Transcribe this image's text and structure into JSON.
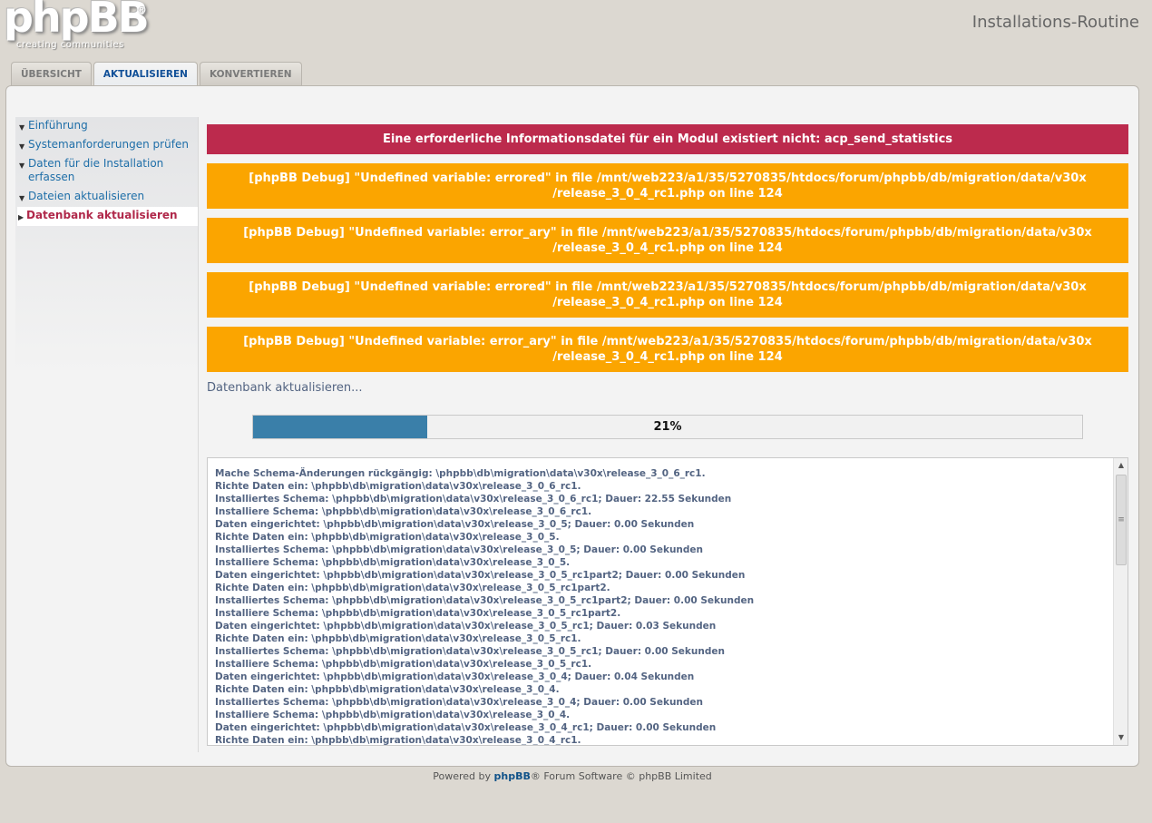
{
  "header": {
    "logo_text": "phpBB",
    "logo_registered": "®",
    "logo_tagline": "creating   communities",
    "page_title": "Installations-Routine"
  },
  "tabs": [
    {
      "label": "ÜBERSICHT",
      "active": false
    },
    {
      "label": "AKTUALISIEREN",
      "active": true
    },
    {
      "label": "KONVERTIEREN",
      "active": false
    }
  ],
  "sidebar": {
    "items": [
      {
        "label": "Einführung"
      },
      {
        "label": "Systemanforderungen prüfen"
      },
      {
        "label": "Daten für die Installation erfassen"
      },
      {
        "label": "Dateien aktualisieren"
      },
      {
        "label": "Datenbank aktualisieren",
        "active": true
      }
    ]
  },
  "messages": {
    "error": "Eine erforderliche Informationsdatei für ein Modul existiert nicht: acp_send_statistics",
    "debug": [
      {
        "line1": "[phpBB Debug] \"Undefined variable: errored\" in file /mnt/web223/a1/35/5270835/htdocs/forum/phpbb/db/migration/data/v30x",
        "line2": "/release_3_0_4_rc1.php on line 124"
      },
      {
        "line1": "[phpBB Debug] \"Undefined variable: error_ary\" in file /mnt/web223/a1/35/5270835/htdocs/forum/phpbb/db/migration/data/v30x",
        "line2": "/release_3_0_4_rc1.php on line 124"
      },
      {
        "line1": "[phpBB Debug] \"Undefined variable: errored\" in file /mnt/web223/a1/35/5270835/htdocs/forum/phpbb/db/migration/data/v30x",
        "line2": "/release_3_0_4_rc1.php on line 124"
      },
      {
        "line1": "[phpBB Debug] \"Undefined variable: error_ary\" in file /mnt/web223/a1/35/5270835/htdocs/forum/phpbb/db/migration/data/v30x",
        "line2": "/release_3_0_4_rc1.php on line 124"
      }
    ]
  },
  "status_text": "Datenbank aktualisieren...",
  "progress": {
    "percent": 21,
    "label": "21%"
  },
  "log_lines": [
    "Mache Schema-Änderungen rückgängig: \\phpbb\\db\\migration\\data\\v30x\\release_3_0_6_rc1.",
    "Richte Daten ein: \\phpbb\\db\\migration\\data\\v30x\\release_3_0_6_rc1.",
    "Installiertes Schema: \\phpbb\\db\\migration\\data\\v30x\\release_3_0_6_rc1; Dauer: 22.55 Sekunden",
    "Installiere Schema: \\phpbb\\db\\migration\\data\\v30x\\release_3_0_6_rc1.",
    "Daten eingerichtet: \\phpbb\\db\\migration\\data\\v30x\\release_3_0_5; Dauer: 0.00 Sekunden",
    "Richte Daten ein: \\phpbb\\db\\migration\\data\\v30x\\release_3_0_5.",
    "Installiertes Schema: \\phpbb\\db\\migration\\data\\v30x\\release_3_0_5; Dauer: 0.00 Sekunden",
    "Installiere Schema: \\phpbb\\db\\migration\\data\\v30x\\release_3_0_5.",
    "Daten eingerichtet: \\phpbb\\db\\migration\\data\\v30x\\release_3_0_5_rc1part2; Dauer: 0.00 Sekunden",
    "Richte Daten ein: \\phpbb\\db\\migration\\data\\v30x\\release_3_0_5_rc1part2.",
    "Installiertes Schema: \\phpbb\\db\\migration\\data\\v30x\\release_3_0_5_rc1part2; Dauer: 0.00 Sekunden",
    "Installiere Schema: \\phpbb\\db\\migration\\data\\v30x\\release_3_0_5_rc1part2.",
    "Daten eingerichtet: \\phpbb\\db\\migration\\data\\v30x\\release_3_0_5_rc1; Dauer: 0.03 Sekunden",
    "Richte Daten ein: \\phpbb\\db\\migration\\data\\v30x\\release_3_0_5_rc1.",
    "Installiertes Schema: \\phpbb\\db\\migration\\data\\v30x\\release_3_0_5_rc1; Dauer: 0.00 Sekunden",
    "Installiere Schema: \\phpbb\\db\\migration\\data\\v30x\\release_3_0_5_rc1.",
    "Daten eingerichtet: \\phpbb\\db\\migration\\data\\v30x\\release_3_0_4; Dauer: 0.04 Sekunden",
    "Richte Daten ein: \\phpbb\\db\\migration\\data\\v30x\\release_3_0_4.",
    "Installiertes Schema: \\phpbb\\db\\migration\\data\\v30x\\release_3_0_4; Dauer: 0.00 Sekunden",
    "Installiere Schema: \\phpbb\\db\\migration\\data\\v30x\\release_3_0_4.",
    "Daten eingerichtet: \\phpbb\\db\\migration\\data\\v30x\\release_3_0_4_rc1; Dauer: 0.00 Sekunden",
    "Richte Daten ein: \\phpbb\\db\\migration\\data\\v30x\\release_3_0_4_rc1."
  ],
  "footer": {
    "prefix": "Powered by ",
    "link": "phpBB",
    "suffix": "® Forum Software © phpBB Limited"
  },
  "colors": {
    "error": "#bc2a4d",
    "debug": "#fba500",
    "progress": "#3a7fa9",
    "link": "#1e6ea8",
    "active_menu": "#b0284a"
  }
}
